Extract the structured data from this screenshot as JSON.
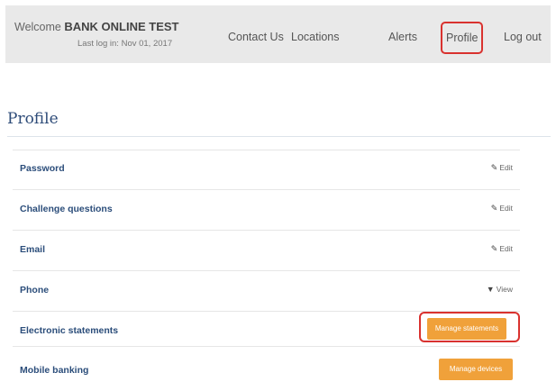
{
  "header": {
    "welcome_prefix": "Welcome",
    "user_name": "BANK ONLINE TEST",
    "last_login": "Last log in: Nov 01, 2017",
    "nav": {
      "contact": "Contact Us",
      "locations": "Locations",
      "alerts": "Alerts",
      "profile": "Profile",
      "logout": "Log out"
    }
  },
  "page": {
    "title": "Profile"
  },
  "rows": [
    {
      "label": "Password",
      "action": "Edit",
      "action_icon": "edit-icon"
    },
    {
      "label": "Challenge questions",
      "action": "Edit",
      "action_icon": "edit-icon"
    },
    {
      "label": "Email",
      "action": "Edit",
      "action_icon": "edit-icon"
    },
    {
      "label": "Phone",
      "action": "View",
      "action_icon": "chevron-down-icon"
    },
    {
      "label": "Electronic statements",
      "action": "Manage statements"
    },
    {
      "label": "Mobile banking",
      "action": "Manage devices"
    }
  ],
  "colors": {
    "accent_orange": "#f0a13a",
    "highlight_red": "#d9322f",
    "link_blue": "#2b4d7a",
    "topbar_gray": "#e9e9e9"
  }
}
